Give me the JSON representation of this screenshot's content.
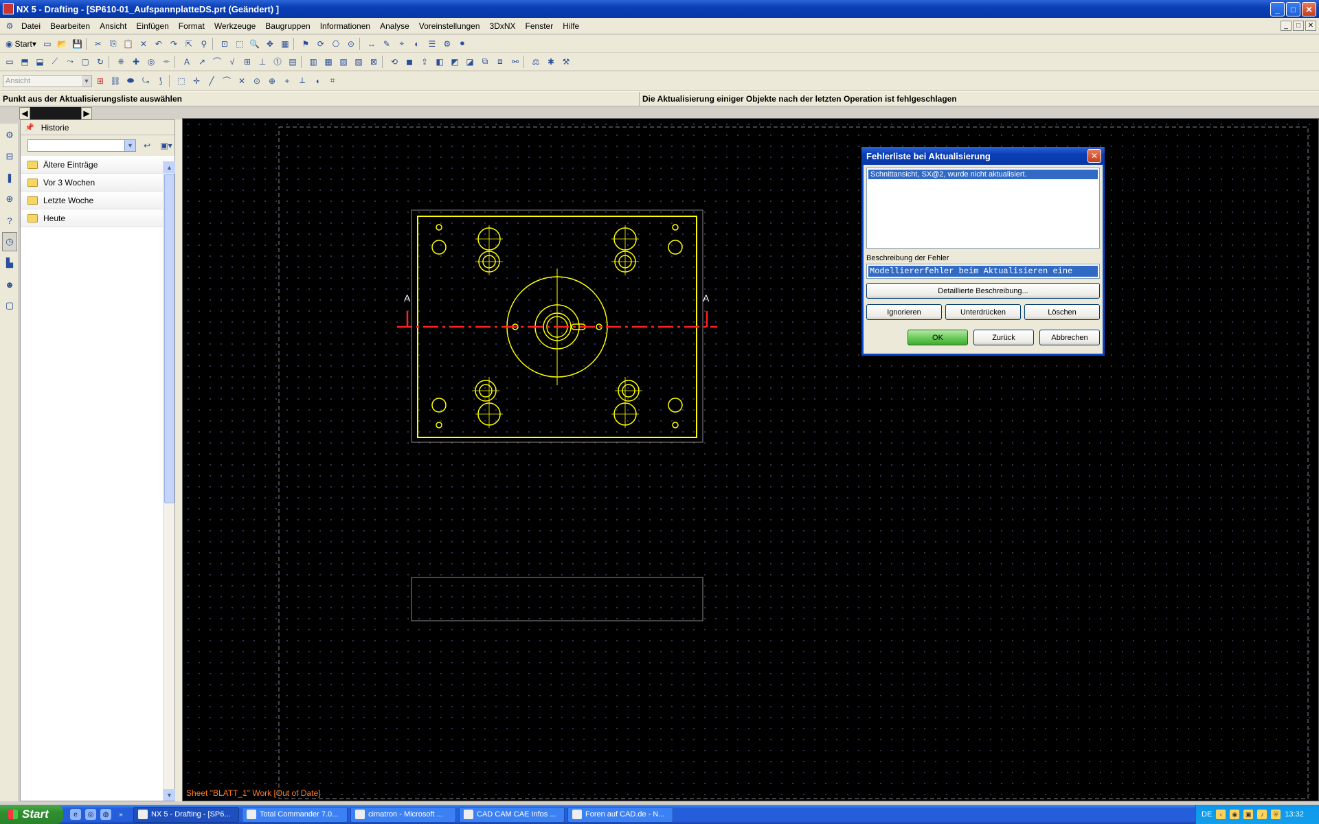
{
  "window": {
    "title": "NX 5 - Drafting - [SP610-01_AufspannplatteDS.prt (Geändert) ]",
    "controls": {
      "minimize": "_",
      "maximize": "□",
      "close": "✕"
    }
  },
  "menu": {
    "items": [
      "Datei",
      "Bearbeiten",
      "Ansicht",
      "Einfügen",
      "Format",
      "Werkzeuge",
      "Baugruppen",
      "Informationen",
      "Analyse",
      "Voreinstellungen",
      "3DxNX",
      "Fenster",
      "Hilfe"
    ]
  },
  "toolbar": {
    "start_label": "Start",
    "view_select_value": "Ansicht"
  },
  "status": {
    "prompt": "Punkt aus der Aktualisierungsliste auswählen",
    "message": "Die Aktualisierung einiger Objekte nach der letzten Operation ist fehlgeschlagen"
  },
  "history_panel": {
    "title": "Historie",
    "groups": [
      "Ältere Einträge",
      "Vor 3 Wochen",
      "Letzte Woche",
      "Heute"
    ]
  },
  "canvas": {
    "sheet_status": "Sheet \"BLATT_1\" Work [Out of Date]",
    "section_labels": {
      "left": "A",
      "right": "A"
    },
    "colors": {
      "geometry": "#ffff00",
      "section_line": "#ff2020",
      "background": "#000000"
    }
  },
  "dialog": {
    "title": "Fehlerliste bei Aktualisierung",
    "list_items": [
      "Schnittansicht, SX@2, wurde nicht aktualisiert."
    ],
    "description_label": "Beschreibung der Fehler",
    "description_value": "Modelliererfehler beim Aktualisieren eine",
    "detail_button": "Detaillierte Beschreibung...",
    "ignore_button": "Ignorieren",
    "suppress_button": "Unterdrücken",
    "delete_button": "Löschen",
    "ok_button": "OK",
    "back_button": "Zurück",
    "cancel_button": "Abbrechen"
  },
  "taskbar": {
    "start_label": "Start",
    "tasks": [
      "NX 5 - Drafting - [SP6...",
      "Total Commander 7.0...",
      "cimatron - Microsoft ...",
      "CAD CAM CAE Infos ...",
      "Foren auf CAD.de - N..."
    ],
    "language": "DE",
    "clock": "13:32"
  }
}
